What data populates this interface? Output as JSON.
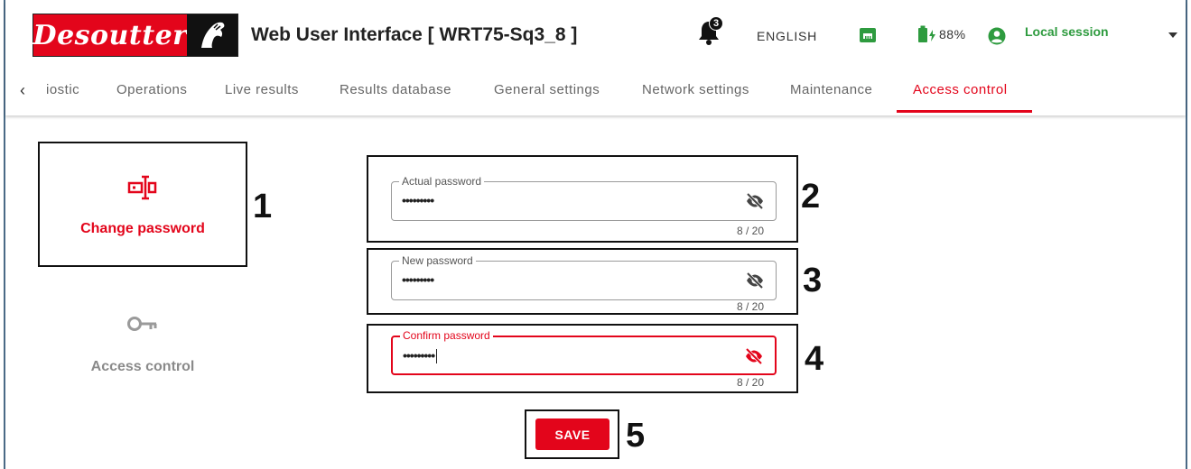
{
  "header": {
    "brand": "Desoutter",
    "title": "Web User Interface [ WRT75-Sq3_8 ]",
    "notifications_count": "3",
    "language": "ENGLISH",
    "battery": "88%",
    "session": "Local session"
  },
  "tabs": [
    {
      "label": "iostic"
    },
    {
      "label": "Operations"
    },
    {
      "label": "Live results"
    },
    {
      "label": "Results database"
    },
    {
      "label": "General settings"
    },
    {
      "label": "Network settings"
    },
    {
      "label": "Maintenance"
    },
    {
      "label": "Access control",
      "active": true
    }
  ],
  "sidebar": {
    "items": [
      {
        "label": "Change password",
        "icon": "password-field-icon",
        "active": true
      },
      {
        "label": "Access control",
        "icon": "key-icon",
        "active": false
      }
    ]
  },
  "form": {
    "actual": {
      "label": "Actual password",
      "value": "•••••••••",
      "counter": "8 / 20"
    },
    "new": {
      "label": "New password",
      "value": "•••••••••",
      "counter": "8 / 20"
    },
    "confirm": {
      "label": "Confirm password",
      "value": "•••••••••",
      "counter": "8 / 20"
    },
    "save_label": "SAVE"
  },
  "callouts": [
    "1",
    "2",
    "3",
    "4",
    "5"
  ],
  "colors": {
    "accent": "#e3051b",
    "session": "#2e9b3f",
    "muted": "#9a9a9a"
  }
}
